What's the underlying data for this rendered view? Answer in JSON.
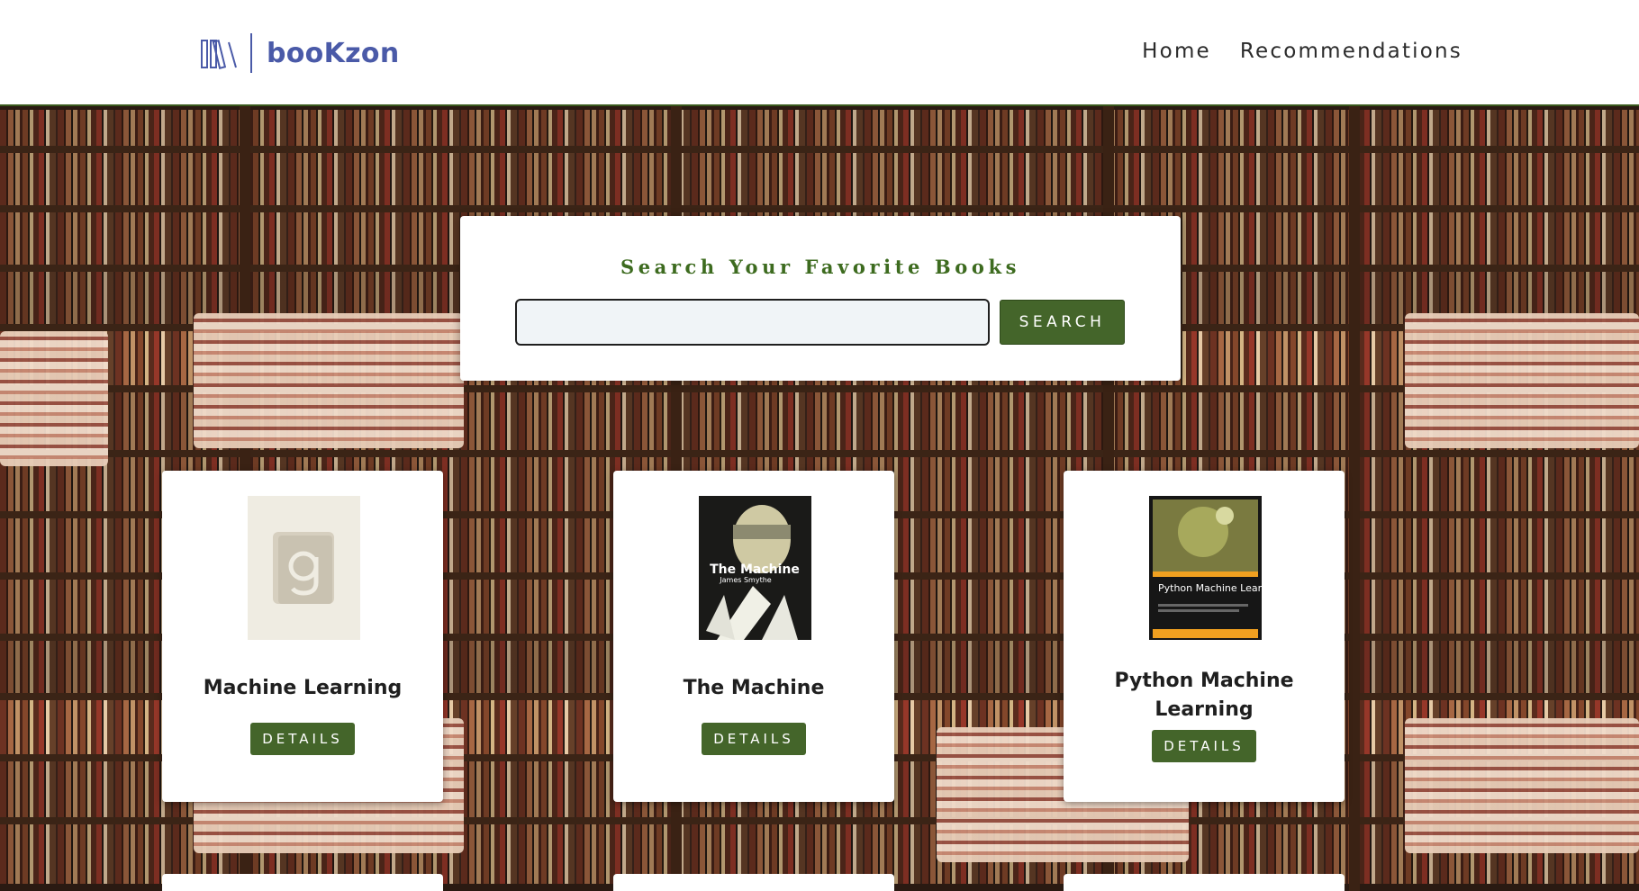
{
  "header": {
    "brand": "booKzon",
    "logo_icon": "bookshelf-icon",
    "nav": [
      {
        "label": "Home"
      },
      {
        "label": "Recommendations"
      }
    ]
  },
  "search": {
    "title": "Search Your Favorite Books",
    "input_value": "",
    "button_label": "SEARCH"
  },
  "books": [
    {
      "title": "Machine Learning",
      "button_label": "DETAILS",
      "cover": "placeholder-g-cover"
    },
    {
      "title": "The Machine",
      "button_label": "DETAILS",
      "cover": "the-machine-cover",
      "cover_text": "The Machine",
      "cover_author": "James Smythe"
    },
    {
      "title": "Python Machine Learning",
      "button_label": "DETAILS",
      "cover": "python-ml-cover",
      "cover_text": "Python Machine Learning"
    }
  ],
  "colors": {
    "brand": "#4a5aa8",
    "accent_green": "#44652a",
    "title_green": "#3d6b1f"
  }
}
